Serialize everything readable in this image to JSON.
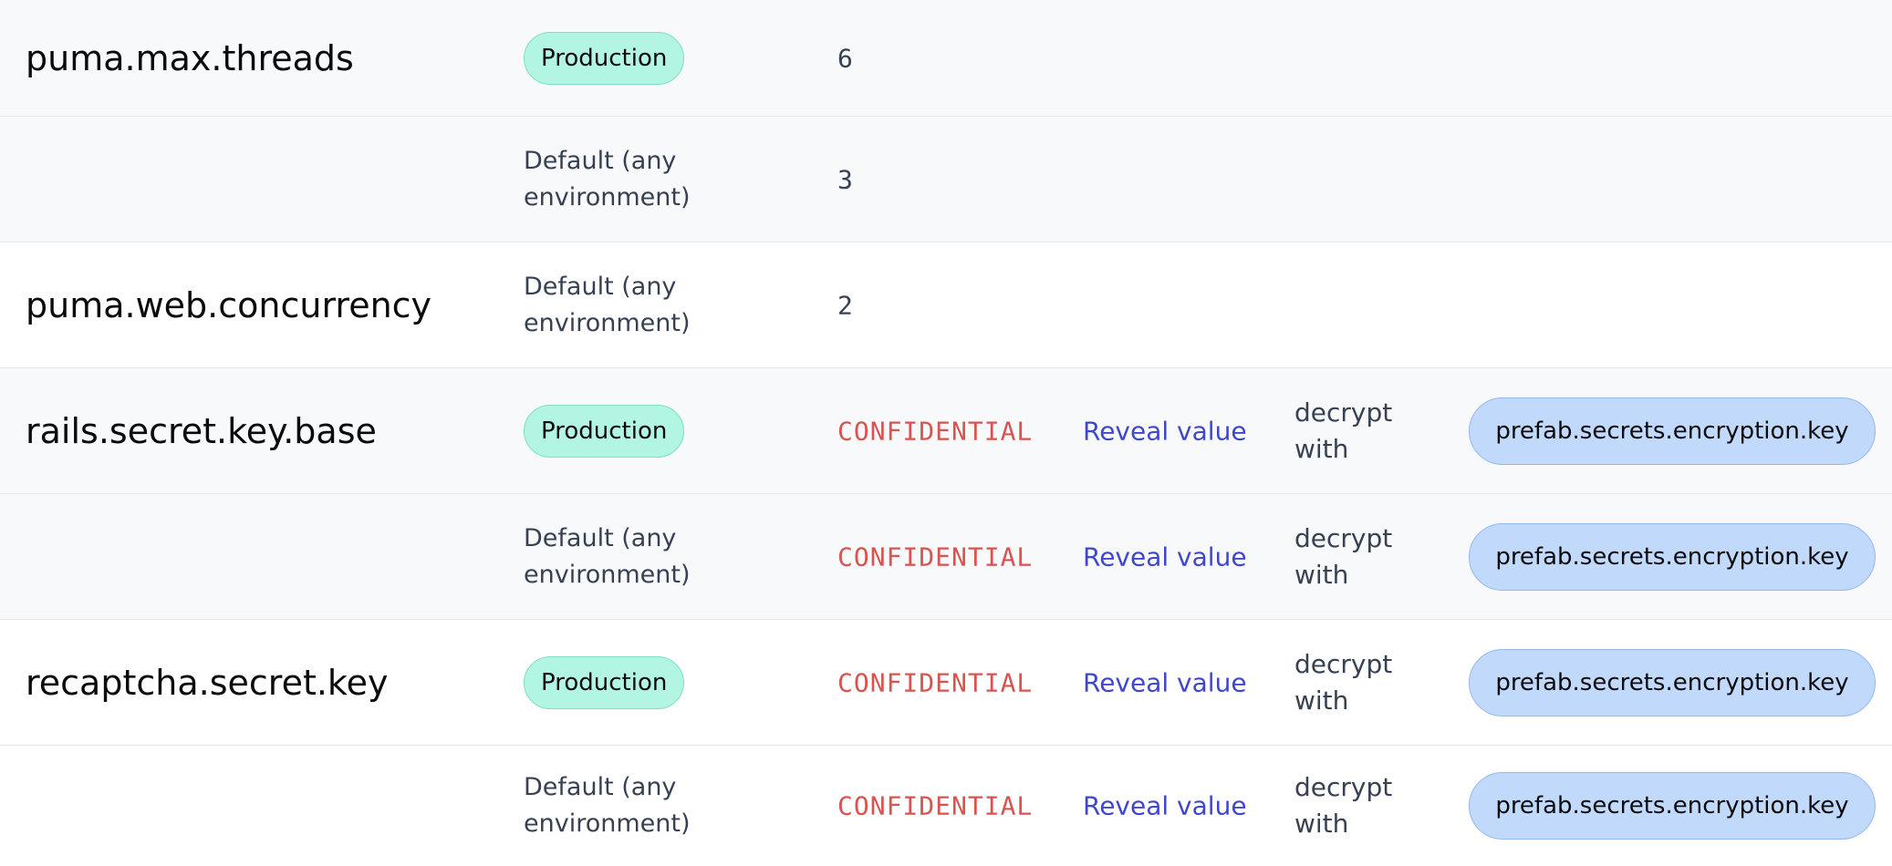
{
  "rows": [
    {
      "key": "puma.max.threads",
      "env": "Production",
      "value": "6"
    },
    {
      "key": "",
      "env": "Default (any environment)",
      "value": "3"
    },
    {
      "key": "puma.web.concurrency",
      "env": "Default (any environment)",
      "value": "2"
    },
    {
      "key": "rails.secret.key.base",
      "env": "Production",
      "value": "CONFIDENTIAL",
      "reveal": "Reveal value",
      "decrypt": "decrypt with",
      "enc_key": "prefab.secrets.encryption.key"
    },
    {
      "key": "",
      "env": "Default (any environment)",
      "value": "CONFIDENTIAL",
      "reveal": "Reveal value",
      "decrypt": "decrypt with",
      "enc_key": "prefab.secrets.encryption.key"
    },
    {
      "key": "recaptcha.secret.key",
      "env": "Production",
      "value": "CONFIDENTIAL",
      "reveal": "Reveal value",
      "decrypt": "decrypt with",
      "enc_key": "prefab.secrets.encryption.key"
    },
    {
      "key": "",
      "env": "Default (any environment)",
      "value": "CONFIDENTIAL",
      "reveal": "Reveal value",
      "decrypt": "decrypt with",
      "enc_key": "prefab.secrets.encryption.key"
    }
  ],
  "colors": {
    "production_badge": "#b2f5e3",
    "key_badge": "#c1d9fb",
    "confidential": "#d9534f",
    "link": "#3f48cc"
  }
}
